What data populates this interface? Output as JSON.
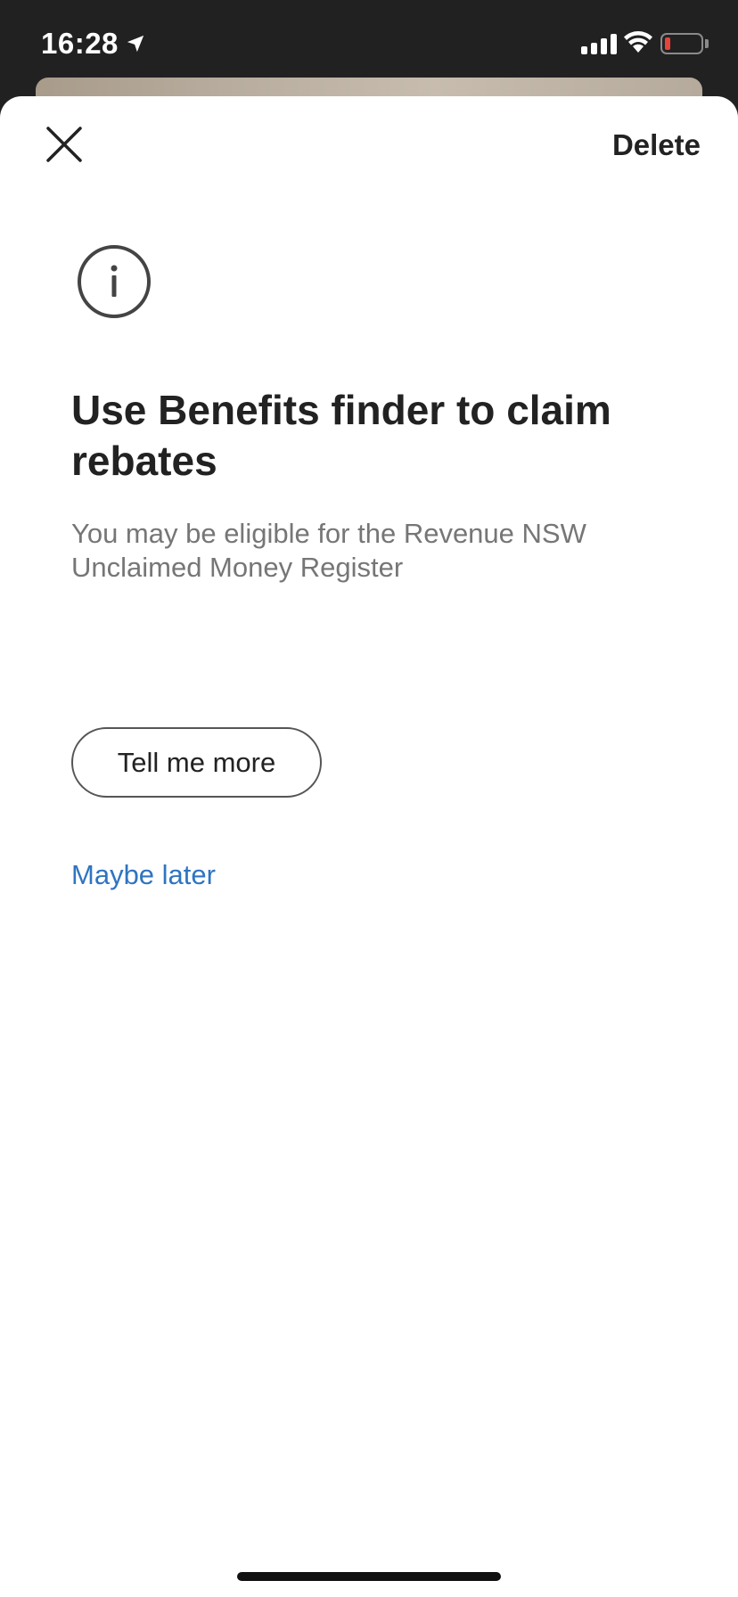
{
  "status_bar": {
    "time": "16:28",
    "battery_level": 0.15,
    "battery_color": "#e5443b"
  },
  "header": {
    "close_icon": "close-icon",
    "delete_label": "Delete"
  },
  "content": {
    "icon": "info-circle-icon",
    "headline": "Use Benefits finder to claim rebates",
    "body": "You may be eligible for the Revenue NSW Unclaimed Money Register",
    "primary_button": "Tell me more",
    "secondary_link": "Maybe later",
    "link_color": "#2f74c0"
  }
}
